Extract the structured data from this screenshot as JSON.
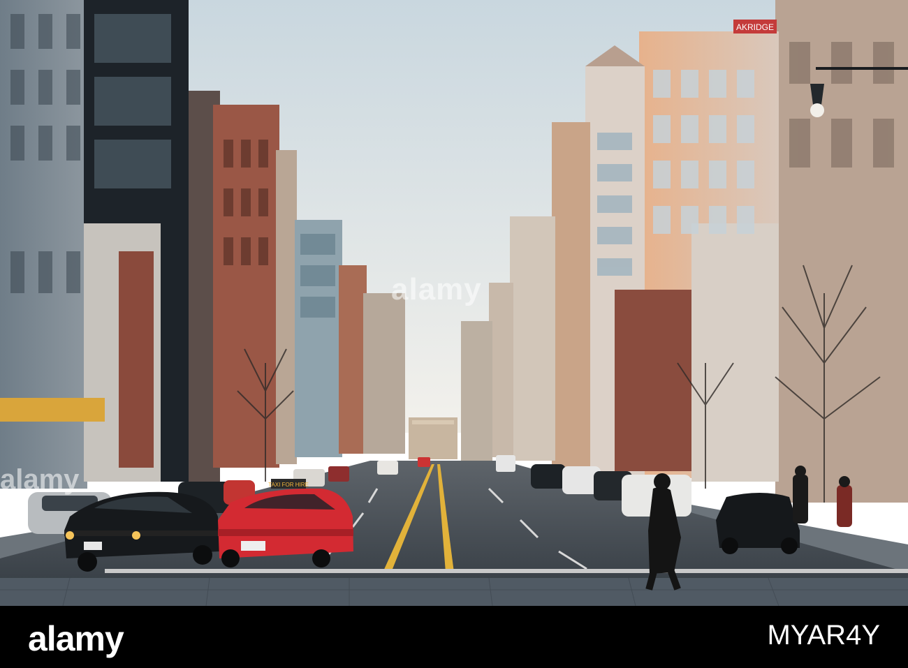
{
  "watermark": {
    "center_text": "alamy",
    "left_text": "alamy"
  },
  "footer": {
    "logo_text": "alamy",
    "image_code": "MYAR4Y",
    "background": "#000000"
  },
  "signs": {
    "akridge": "AKRIDGE",
    "taxi_roof": "TAXI FOR HIRE"
  },
  "colors": {
    "sky": "#e9edee",
    "road": "#4a5259",
    "taxi": "#d32a32",
    "sidewalk": "#5d6670"
  }
}
